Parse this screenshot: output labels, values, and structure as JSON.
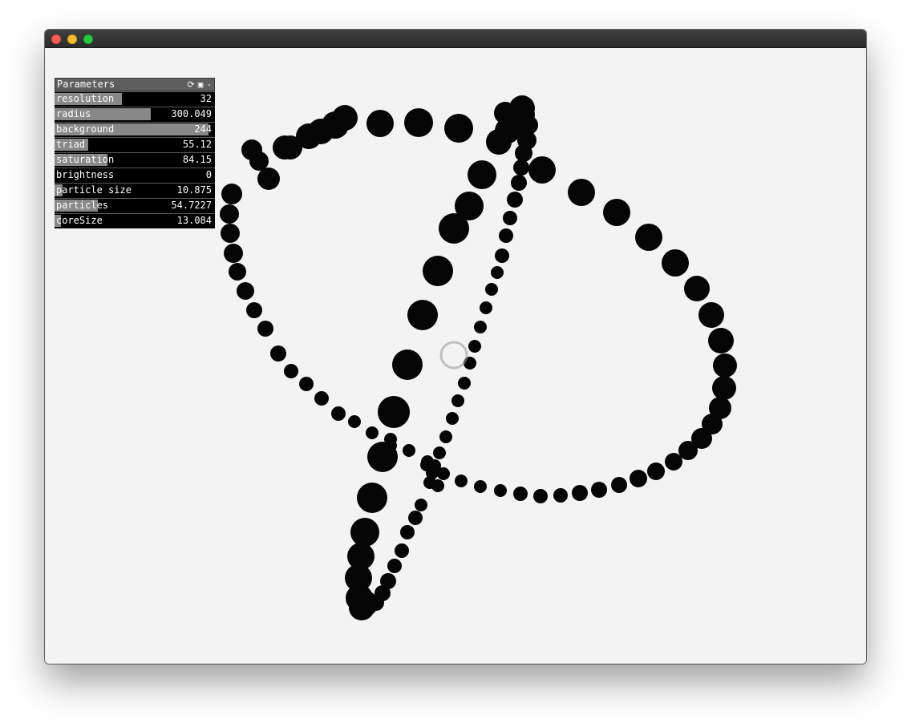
{
  "window": {
    "traffic_lights": [
      {
        "name": "close",
        "color": "#fc5f57",
        "border": "#de4a40"
      },
      {
        "name": "minimize",
        "color": "#fdbc2e",
        "border": "#de9f1a"
      },
      {
        "name": "zoom",
        "color": "#28c840",
        "border": "#1aab2a"
      }
    ]
  },
  "canvas": {
    "background_color": "#f3f3f3",
    "particle_color": "#050505"
  },
  "parameters_panel": {
    "title": "Parameters",
    "icons": [
      "refresh-icon",
      "save-icon",
      "minimize-icon"
    ],
    "icon_glyphs": [
      "⟳",
      "▣",
      "-"
    ],
    "rows": [
      {
        "key": "resolution",
        "label": "resolution",
        "value": "32",
        "fill": 0.42
      },
      {
        "key": "radius",
        "label": "radius",
        "value": "300.049",
        "fill": 0.6
      },
      {
        "key": "background",
        "label": "background",
        "value": "244",
        "fill": 0.96
      },
      {
        "key": "triad",
        "label": "triad",
        "value": "55.12",
        "fill": 0.21
      },
      {
        "key": "saturation",
        "label": "saturation",
        "value": "84.15",
        "fill": 0.33
      },
      {
        "key": "brightness",
        "label": "brightness",
        "value": "0",
        "fill": 0.0
      },
      {
        "key": "particle-size",
        "label": "particle size",
        "value": "10.875",
        "fill": 0.05
      },
      {
        "key": "particles",
        "label": "particles",
        "value": "54.7227",
        "fill": 0.27
      },
      {
        "key": "coresize",
        "label": "coreSize",
        "value": "13.084",
        "fill": 0.04
      }
    ]
  }
}
